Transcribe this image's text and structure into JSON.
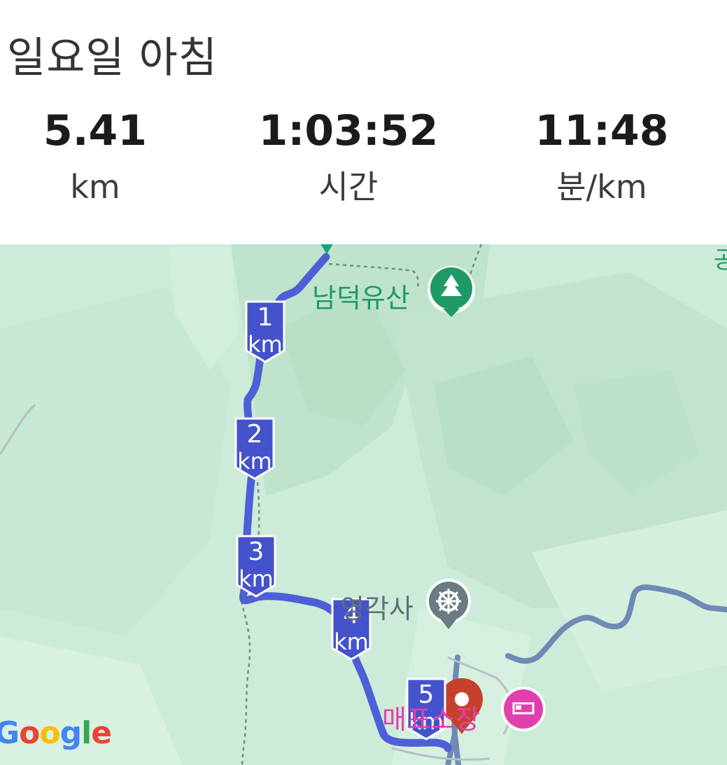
{
  "header": {
    "title": "일요일 아침"
  },
  "stats": [
    {
      "value": "5.41",
      "unit": "km"
    },
    {
      "value": "1:03:52",
      "unit": "시간"
    },
    {
      "value": "11:48",
      "unit": "분/km"
    }
  ],
  "map": {
    "km_markers": [
      {
        "number": "1",
        "unit": "km"
      },
      {
        "number": "2",
        "unit": "km"
      },
      {
        "number": "3",
        "unit": "km"
      },
      {
        "number": "4",
        "unit": "km"
      },
      {
        "number": "5",
        "unit": "km"
      }
    ],
    "pois": {
      "mountain": "남덕유산",
      "temple": "영각사",
      "lodging": "매표소장"
    },
    "attribution": "Google",
    "colors": {
      "route": "#4f5fd6",
      "marker": "#4452cc",
      "end_pin": "#c5412b",
      "start_pin": "#12a583",
      "poi_green": "#1f9a66",
      "poi_gray": "#6a7b82",
      "poi_pink": "#e23fae"
    }
  }
}
